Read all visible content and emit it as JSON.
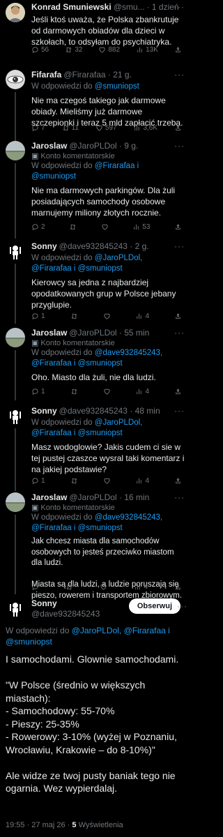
{
  "tweets": [
    {
      "name": "Konrad Smuniewski",
      "handle": "@smu...",
      "time": "· 1 dzień",
      "text": "Jeśli ktoś uważa, że Polska zbankrutuje od darmowych obiadów dla dzieci w szkołach, to odsyłam do psychiatryka.",
      "replies": "56",
      "retweets": "32",
      "likes": "882",
      "views": "13K"
    },
    {
      "name": "Fifarafa",
      "handle": "@Firarafaa · 21 g.",
      "reply_prefix": "W odpowiedzi do ",
      "reply_to": "@smuniopst",
      "text": "Nie ma czegoś takiego jak darmowe obiady. Mieliśmy już darmowe szczepionki i teraz 5 mld zapłacić trzeba.",
      "replies": "7",
      "retweets": "11",
      "likes": "597",
      "views": "3,6K"
    },
    {
      "name": "Jaroslaw",
      "handle": "@JaroPLDol · 9 g.",
      "badge": "Konto komentatorskie",
      "reply_prefix": "W odpowiedzi do ",
      "reply_to": "@Firarafaa i @smuniopst",
      "text": "Nie ma darmowych parkingów. Dla żuli posiadających samochody osobowe marnujemy miliony złotych rocznie.",
      "replies": "2",
      "retweets": "",
      "likes": "",
      "views": "53"
    },
    {
      "name": "Sonny",
      "handle": "@dave932845243 · 2 g.",
      "reply_prefix": "W odpowiedzi do ",
      "reply_to": "@JaroPLDol, @Firarafaa i @smuniopst",
      "text": "Kierowcy sa jedna z najbardziej opodatkowanych grup w Polsce jebany przyglupie.",
      "replies": "1",
      "retweets": "",
      "likes": "",
      "views": "4"
    },
    {
      "name": "Jaroslaw",
      "handle": "@JaroPLDol · 55 min",
      "badge": "Konto komentatorskie",
      "reply_prefix": "W odpowiedzi do ",
      "reply_to": "@dave932845243, @Firarafaa i @smuniopst",
      "text": "Oho. Miasto dla żuli, nie dla ludzi.",
      "replies": "1",
      "retweets": "",
      "likes": "",
      "views": "4"
    },
    {
      "name": "Sonny",
      "handle": "@dave932845243 · 48 min",
      "reply_prefix": "W odpowiedzi do ",
      "reply_to": "@JaroPLDol, @Firarafaa i @smuniopst",
      "text": "Masz wodoglowie? Jakis cudem ci sie w tej pustej czaszce wysral taki komentarz i na jakiej podstawie?",
      "replies": "1",
      "retweets": "",
      "likes": "",
      "views": "4"
    },
    {
      "name": "Jaroslaw",
      "handle": "@JaroPLDol · 16 min",
      "badge": "Konto komentatorskie",
      "reply_prefix": "W odpowiedzi do ",
      "reply_to": "@dave932845243, @Firarafaa i @smuniopst",
      "text": "Jak chcesz miasta dla samochodów osobowych to jesteś przeciwko miastom dla ludzi.\n\nMiasta są dla ludzi, a ludzie poruszają się pieszo, rowerem i transportem zbiorowym.",
      "replies": "",
      "retweets": "",
      "likes": "",
      "views": "4"
    }
  ],
  "main": {
    "name": "Sonny",
    "handle": "@dave932845243",
    "follow_label": "Obserwuj",
    "reply_prefix": "W odpowiedzi do ",
    "reply_to": "@JaroPLDol, @Firarafaa i @smuniopst",
    "text": "I samochodami. Glownie samochodami.\n\n\"W Polsce (średnio w większych miastach):\n- Samochodowy: 55-70%\n- Pieszy: 25-35%\n- Rowerowy: 3-10% (wyżej w Poznaniu, Wrocławiu, Krakowie – do 8-10%)\"\n\nAle widze ze twoj pusty baniak tego nie ogarnia. Wez wypierdalaj.",
    "timestamp": "19:55 · 27 maj 26 · ",
    "views_count": "5",
    "views_label": " Wyświetlenia"
  },
  "icons": {
    "reply": "speech-bubble-icon",
    "retweet": "retweet-icon",
    "like": "heart-icon",
    "views": "bar-chart-icon",
    "share": "share-icon",
    "badge": "komentator-badge-icon",
    "more": "more-dots-icon"
  },
  "colors": {
    "background": "#000000",
    "text": "#e7e9ea",
    "muted": "#71767b",
    "link": "#1d9bf0"
  }
}
